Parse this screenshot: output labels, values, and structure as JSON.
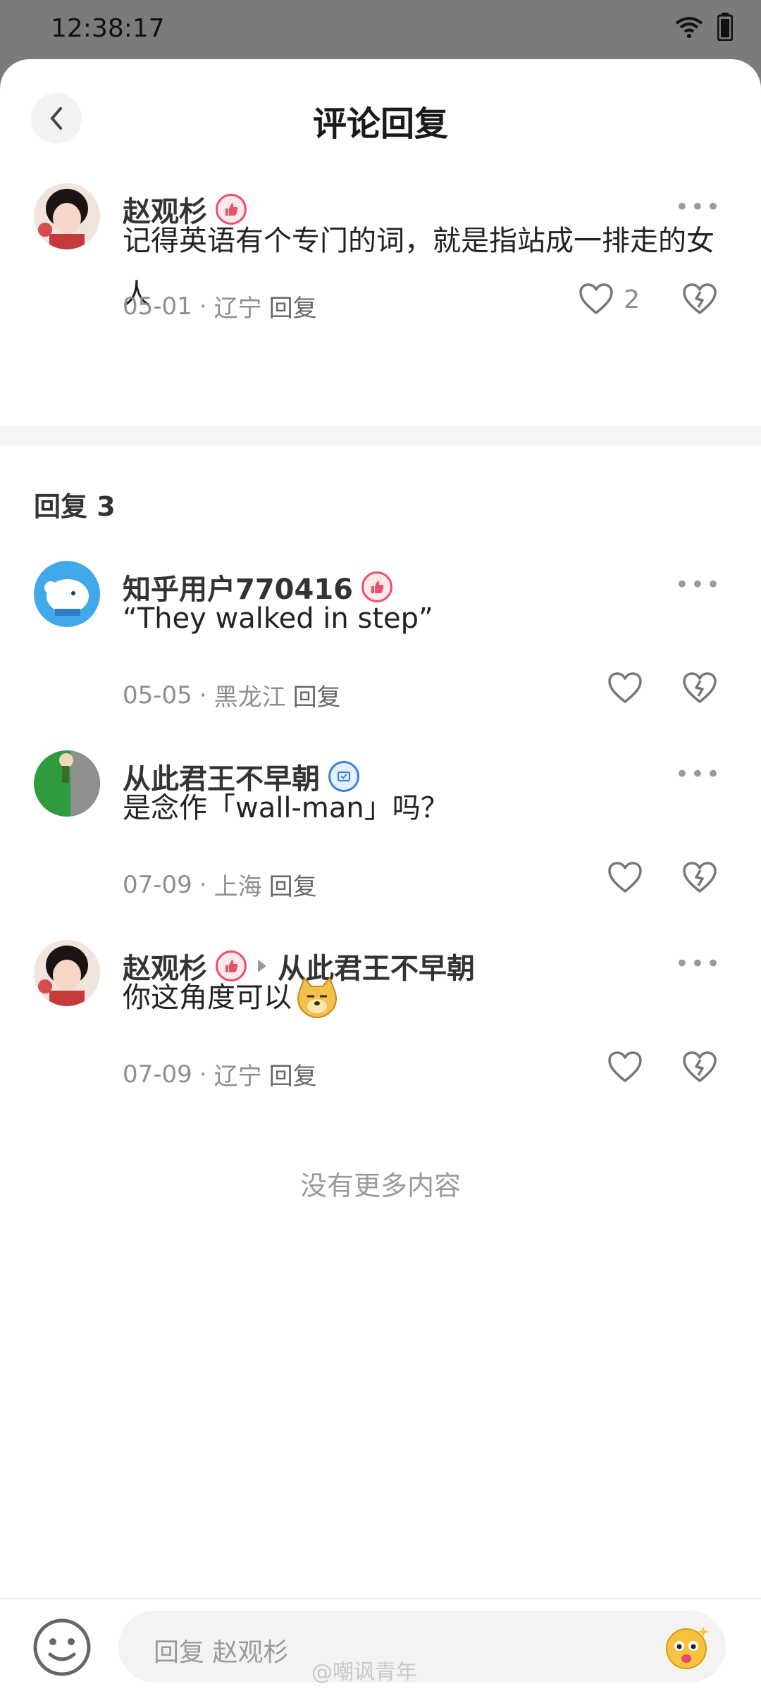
{
  "status": {
    "time": "12:38:17"
  },
  "header": {
    "title": "评论回复"
  },
  "main_comment": {
    "author": "赵观杉",
    "text": "记得英语有个专门的词，就是指站成一排走的女人",
    "date": "05-01",
    "location": "辽宁",
    "reply_label": "回复",
    "likes": "2"
  },
  "replies_section": {
    "label": "回复 3"
  },
  "replies": [
    {
      "author": "知乎用户770416",
      "text": "“They walked in step”",
      "date": "05-05",
      "location": "黑龙江",
      "reply_label": "回复"
    },
    {
      "author": "从此君王不早朝",
      "text": "是念作「wall-man」吗？",
      "date": "07-09",
      "location": "上海",
      "reply_label": "回复"
    },
    {
      "author": "赵观杉",
      "reply_to": "从此君王不早朝",
      "text": "你这角度可以",
      "date": "07-09",
      "location": "辽宁",
      "reply_label": "回复"
    }
  ],
  "footer": {
    "no_more": "没有更多内容"
  },
  "input": {
    "placeholder": "回复 赵观杉"
  },
  "watermark": "@嘲讽青年",
  "colors": {
    "badge_red": "#e9506a",
    "badge_blue": "#3b7fe0",
    "meta_gray": "#8e8e8e"
  }
}
